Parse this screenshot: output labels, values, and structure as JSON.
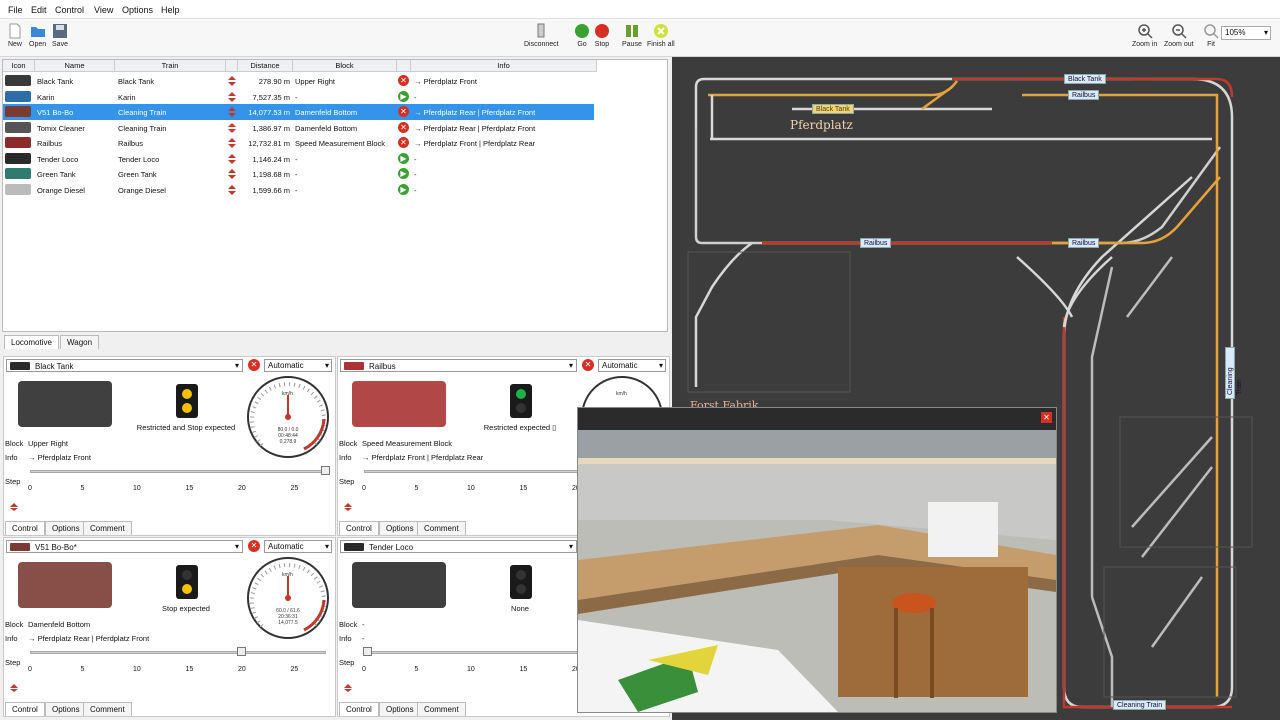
{
  "menu": [
    "File",
    "Edit",
    "Control",
    "View",
    "Options",
    "Help"
  ],
  "toolbar": {
    "new": "New",
    "open": "Open",
    "save": "Save",
    "disconnect": "Disconnect",
    "go": "Go",
    "stop": "Stop",
    "pause": "Pause",
    "finish_all": "Finish all",
    "zoom_in": "Zoom in",
    "zoom_out": "Zoom out",
    "fit": "Fit",
    "zoom_value": "105%"
  },
  "table": {
    "headers": [
      "Icon",
      "Name",
      "Train",
      "Distance",
      "Block",
      "Info"
    ],
    "rows": [
      {
        "name": "Black Tank",
        "train": "Black Tank",
        "distance": "278.90 m",
        "block": "Upper Right",
        "status": "x",
        "info": "→ Pferdplatz Front",
        "color": "#3a3a3a"
      },
      {
        "name": "Karin",
        "train": "Karin",
        "distance": "7,527.35 m",
        "block": "-",
        "status": "p",
        "info": "-",
        "color": "#2c6fa8"
      },
      {
        "name": "V51 Bo-Bo",
        "train": "Cleaning Train",
        "distance": "14,077.53 m",
        "block": "Damenfeld Bottom",
        "status": "x",
        "info": "→ Pferdplatz Rear | Pferdplatz Front",
        "color": "#7b3b34"
      },
      {
        "name": "Tomix Cleaner",
        "train": "Cleaning Train",
        "distance": "1,386.97 m",
        "block": "Damenfeld Bottom",
        "status": "x",
        "info": "→ Pferdplatz Rear | Pferdplatz Front",
        "color": "#555"
      },
      {
        "name": "Railbus",
        "train": "Railbus",
        "distance": "12,732.81 m",
        "block": "Speed Measurement Block",
        "status": "x",
        "info": "→ Pferdplatz Front | Pferdplatz Rear",
        "color": "#8b2c2c"
      },
      {
        "name": "Tender Loco",
        "train": "Tender Loco",
        "distance": "1,146.24 m",
        "block": "-",
        "status": "p",
        "info": "-",
        "color": "#2a2a2a"
      },
      {
        "name": "Green Tank",
        "train": "Green Tank",
        "distance": "1,198.68 m",
        "block": "-",
        "status": "p",
        "info": "-",
        "color": "#2f7b6f"
      },
      {
        "name": "Orange Diesel",
        "train": "Orange Diesel",
        "distance": "1,599.66 m",
        "block": "-",
        "status": "p",
        "info": "-",
        "color": "#bbb"
      }
    ]
  },
  "tabs": {
    "locomotive": "Locomotive",
    "wagon": "Wagon",
    "control": "Control",
    "options": "Options",
    "comment": "Comment"
  },
  "panels": [
    {
      "name": "Black Tank",
      "mode": "Automatic",
      "signal": "Restricted and Stop expected",
      "block_label": "Block",
      "block": "Upper Right",
      "info_label": "Info",
      "info": "→ Pferdplatz Front",
      "step_label": "Step",
      "speed_readout": "80.0 / 0.0",
      "time": "00:48:44",
      "dist": "0,278.9",
      "thumb": "#2b2b2b"
    },
    {
      "name": "Railbus",
      "mode": "Automatic",
      "signal": "Restricted expected ▯",
      "block_label": "Block",
      "block": "Speed Measurement Block",
      "info_label": "Info",
      "info": "→ Pferdplatz Front | Pferdplatz Rear",
      "step_label": "Step",
      "thumb": "#a33"
    },
    {
      "name": "V51 Bo-Bo*",
      "mode": "Automatic",
      "signal": "Stop expected",
      "block_label": "Block",
      "block": "Damenfeld Bottom",
      "info_label": "Info",
      "info": "→ Pferdplatz Rear | Pferdplatz Front",
      "step_label": "Step",
      "speed_readout": "60.0 / 61.6",
      "time": "20:36:31",
      "dist": "14,077.5",
      "thumb": "#7b3b34"
    },
    {
      "name": "Tender Loco",
      "mode": "",
      "signal": "None",
      "block_label": "Block",
      "block": "-",
      "info_label": "Info",
      "info": "-",
      "step_label": "Step",
      "thumb": "#2a2a2a"
    }
  ],
  "ticks": [
    "0",
    "5",
    "10",
    "15",
    "20",
    "25"
  ],
  "gauge_unit": "km/h",
  "track": {
    "station_label": "Pferdplatz",
    "factory_label": "Forst Fabrik",
    "tags": [
      "Black Tank",
      "Railbus",
      "Black Tank",
      "Railbus",
      "Railbus",
      "Cleaning Train",
      "Cleaning Train"
    ]
  },
  "colors": {
    "selection": "#3394ea",
    "stop": "#d63024",
    "go": "#39a132",
    "track_bg": "#3c3c3c",
    "route_orange": "#e3a23a",
    "route_red": "#c0392b"
  }
}
